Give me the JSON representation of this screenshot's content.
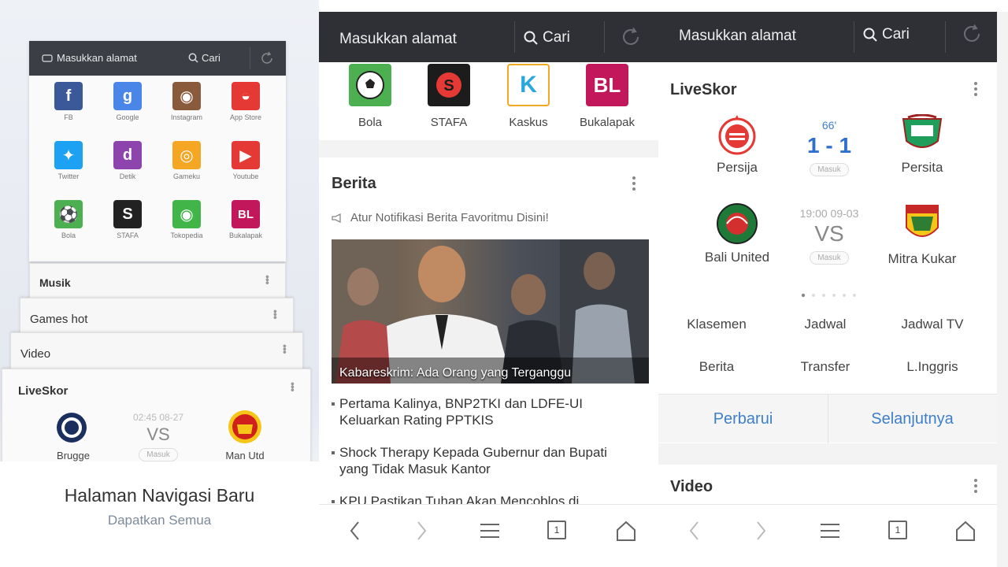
{
  "panel1": {
    "address_bar": {
      "placeholder": "Masukkan alamat",
      "search_label": "Cari"
    },
    "apps": [
      {
        "label": "FB",
        "glyph": "f",
        "color": "#3b5998"
      },
      {
        "label": "Google",
        "glyph": "g",
        "color": "#4a86e8"
      },
      {
        "label": "Instagram",
        "glyph": "◉",
        "color": "#8a5a3c"
      },
      {
        "label": "App Store",
        "glyph": "◒",
        "color": "#e53935"
      },
      {
        "label": "Twitter",
        "glyph": "✦",
        "color": "#1da1f2"
      },
      {
        "label": "Detik",
        "glyph": "d",
        "color": "#8e44ad"
      },
      {
        "label": "Gameku",
        "glyph": "◎",
        "color": "#f5a623"
      },
      {
        "label": "Youtube",
        "glyph": "▶",
        "color": "#e53935"
      },
      {
        "label": "Bola",
        "glyph": "⚽",
        "color": "#4caf50"
      },
      {
        "label": "STAFA",
        "glyph": "S",
        "color": "#222222"
      },
      {
        "label": "Tokopedia",
        "glyph": "◉",
        "color": "#42b549"
      },
      {
        "label": "Bukalapak",
        "glyph": "BL",
        "color": "#c2185b"
      }
    ],
    "cards": [
      "Musik",
      "Games hot",
      "Video",
      "LiveSkor"
    ],
    "liveskor_preview": {
      "time": "02:45 08-27",
      "vs": "VS",
      "status": "Masuk",
      "home": "Brugge",
      "away": "Man Utd"
    },
    "footer_title": "Halaman Navigasi Baru",
    "footer_subtitle": "Dapatkan Semua"
  },
  "panel2": {
    "address_bar": {
      "placeholder": "Masukkan alamat",
      "search_label": "Cari"
    },
    "apps": [
      {
        "label": "Bola",
        "glyph": "⚽",
        "color": "#4caf50"
      },
      {
        "label": "STAFA",
        "glyph": "S",
        "color": "#1c1c1c"
      },
      {
        "label": "Kaskus",
        "glyph": "K",
        "color": "#ffffff"
      },
      {
        "label": "Bukalapak",
        "glyph": "BL",
        "color": "#c2185b"
      }
    ],
    "news": {
      "title": "Berita",
      "notify": "Atur Notifikasi Berita Favoritmu Disini!",
      "photo_caption": "Kabareskrim: Ada Orang yang Terganggu",
      "items": [
        "Pertama Kalinya, BNP2TKI dan LDFE-UI Keluarkan Rating PPTKIS",
        "Shock Therapy Kepada Gubernur dan Bupati yang Tidak Masuk Kantor",
        "KPU Pastikan Tuhan Akan Mencoblos di"
      ]
    },
    "nav": {
      "tab_count": "1"
    }
  },
  "panel3": {
    "address_bar": {
      "placeholder": "Masukkan alamat",
      "search_label": "Cari"
    },
    "liveskor": {
      "title": "LiveSkor",
      "matches": [
        {
          "minute": "66'",
          "score": "1 - 1",
          "status": "Masuk",
          "home": "Persija",
          "away": "Persita"
        },
        {
          "minute": "19:00 09-03",
          "score": "VS",
          "status": "Masuk",
          "home": "Bali United",
          "away": "Mitra Kukar"
        }
      ],
      "links": [
        "Klasemen",
        "Jadwal",
        "Jadwal TV",
        "Berita",
        "Transfer",
        "L.Inggris"
      ],
      "refresh_label": "Perbarui",
      "next_label": "Selanjutnya"
    },
    "video_title": "Video",
    "nav": {
      "tab_count": "1"
    }
  },
  "colors": {
    "topbar": "#2e3036",
    "accent_blue": "#3f7ec9",
    "score_blue": "#2f6fd0"
  }
}
